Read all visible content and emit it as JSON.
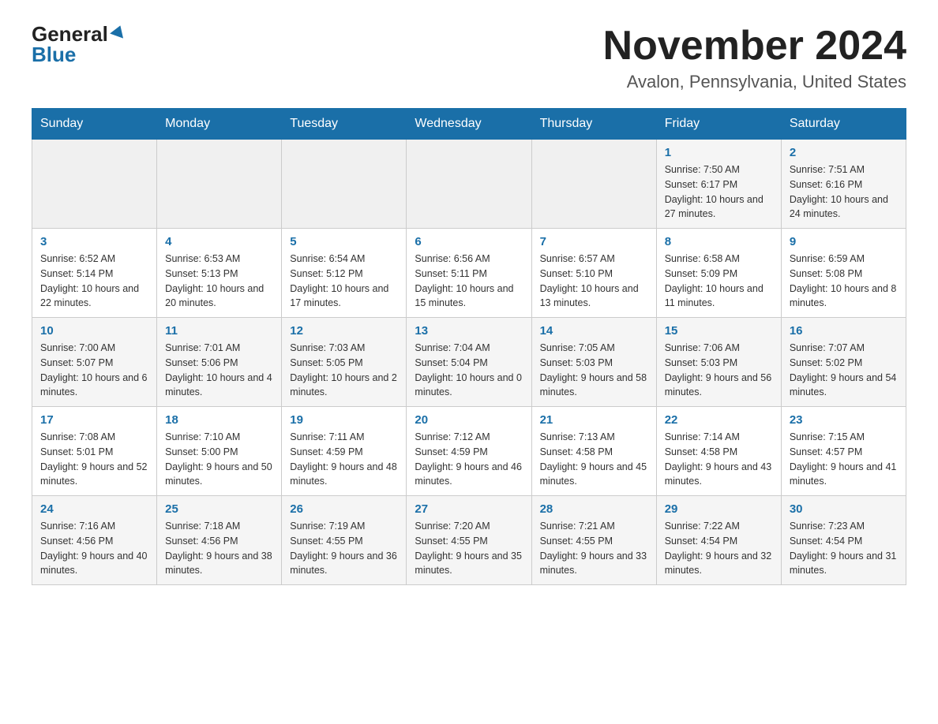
{
  "logo": {
    "general": "General",
    "blue": "Blue"
  },
  "title": "November 2024",
  "location": "Avalon, Pennsylvania, United States",
  "days_of_week": [
    "Sunday",
    "Monday",
    "Tuesday",
    "Wednesday",
    "Thursday",
    "Friday",
    "Saturday"
  ],
  "weeks": [
    {
      "days": [
        {
          "num": "",
          "info": ""
        },
        {
          "num": "",
          "info": ""
        },
        {
          "num": "",
          "info": ""
        },
        {
          "num": "",
          "info": ""
        },
        {
          "num": "",
          "info": ""
        },
        {
          "num": "1",
          "info": "Sunrise: 7:50 AM\nSunset: 6:17 PM\nDaylight: 10 hours and 27 minutes."
        },
        {
          "num": "2",
          "info": "Sunrise: 7:51 AM\nSunset: 6:16 PM\nDaylight: 10 hours and 24 minutes."
        }
      ]
    },
    {
      "days": [
        {
          "num": "3",
          "info": "Sunrise: 6:52 AM\nSunset: 5:14 PM\nDaylight: 10 hours and 22 minutes."
        },
        {
          "num": "4",
          "info": "Sunrise: 6:53 AM\nSunset: 5:13 PM\nDaylight: 10 hours and 20 minutes."
        },
        {
          "num": "5",
          "info": "Sunrise: 6:54 AM\nSunset: 5:12 PM\nDaylight: 10 hours and 17 minutes."
        },
        {
          "num": "6",
          "info": "Sunrise: 6:56 AM\nSunset: 5:11 PM\nDaylight: 10 hours and 15 minutes."
        },
        {
          "num": "7",
          "info": "Sunrise: 6:57 AM\nSunset: 5:10 PM\nDaylight: 10 hours and 13 minutes."
        },
        {
          "num": "8",
          "info": "Sunrise: 6:58 AM\nSunset: 5:09 PM\nDaylight: 10 hours and 11 minutes."
        },
        {
          "num": "9",
          "info": "Sunrise: 6:59 AM\nSunset: 5:08 PM\nDaylight: 10 hours and 8 minutes."
        }
      ]
    },
    {
      "days": [
        {
          "num": "10",
          "info": "Sunrise: 7:00 AM\nSunset: 5:07 PM\nDaylight: 10 hours and 6 minutes."
        },
        {
          "num": "11",
          "info": "Sunrise: 7:01 AM\nSunset: 5:06 PM\nDaylight: 10 hours and 4 minutes."
        },
        {
          "num": "12",
          "info": "Sunrise: 7:03 AM\nSunset: 5:05 PM\nDaylight: 10 hours and 2 minutes."
        },
        {
          "num": "13",
          "info": "Sunrise: 7:04 AM\nSunset: 5:04 PM\nDaylight: 10 hours and 0 minutes."
        },
        {
          "num": "14",
          "info": "Sunrise: 7:05 AM\nSunset: 5:03 PM\nDaylight: 9 hours and 58 minutes."
        },
        {
          "num": "15",
          "info": "Sunrise: 7:06 AM\nSunset: 5:03 PM\nDaylight: 9 hours and 56 minutes."
        },
        {
          "num": "16",
          "info": "Sunrise: 7:07 AM\nSunset: 5:02 PM\nDaylight: 9 hours and 54 minutes."
        }
      ]
    },
    {
      "days": [
        {
          "num": "17",
          "info": "Sunrise: 7:08 AM\nSunset: 5:01 PM\nDaylight: 9 hours and 52 minutes."
        },
        {
          "num": "18",
          "info": "Sunrise: 7:10 AM\nSunset: 5:00 PM\nDaylight: 9 hours and 50 minutes."
        },
        {
          "num": "19",
          "info": "Sunrise: 7:11 AM\nSunset: 4:59 PM\nDaylight: 9 hours and 48 minutes."
        },
        {
          "num": "20",
          "info": "Sunrise: 7:12 AM\nSunset: 4:59 PM\nDaylight: 9 hours and 46 minutes."
        },
        {
          "num": "21",
          "info": "Sunrise: 7:13 AM\nSunset: 4:58 PM\nDaylight: 9 hours and 45 minutes."
        },
        {
          "num": "22",
          "info": "Sunrise: 7:14 AM\nSunset: 4:58 PM\nDaylight: 9 hours and 43 minutes."
        },
        {
          "num": "23",
          "info": "Sunrise: 7:15 AM\nSunset: 4:57 PM\nDaylight: 9 hours and 41 minutes."
        }
      ]
    },
    {
      "days": [
        {
          "num": "24",
          "info": "Sunrise: 7:16 AM\nSunset: 4:56 PM\nDaylight: 9 hours and 40 minutes."
        },
        {
          "num": "25",
          "info": "Sunrise: 7:18 AM\nSunset: 4:56 PM\nDaylight: 9 hours and 38 minutes."
        },
        {
          "num": "26",
          "info": "Sunrise: 7:19 AM\nSunset: 4:55 PM\nDaylight: 9 hours and 36 minutes."
        },
        {
          "num": "27",
          "info": "Sunrise: 7:20 AM\nSunset: 4:55 PM\nDaylight: 9 hours and 35 minutes."
        },
        {
          "num": "28",
          "info": "Sunrise: 7:21 AM\nSunset: 4:55 PM\nDaylight: 9 hours and 33 minutes."
        },
        {
          "num": "29",
          "info": "Sunrise: 7:22 AM\nSunset: 4:54 PM\nDaylight: 9 hours and 32 minutes."
        },
        {
          "num": "30",
          "info": "Sunrise: 7:23 AM\nSunset: 4:54 PM\nDaylight: 9 hours and 31 minutes."
        }
      ]
    }
  ]
}
